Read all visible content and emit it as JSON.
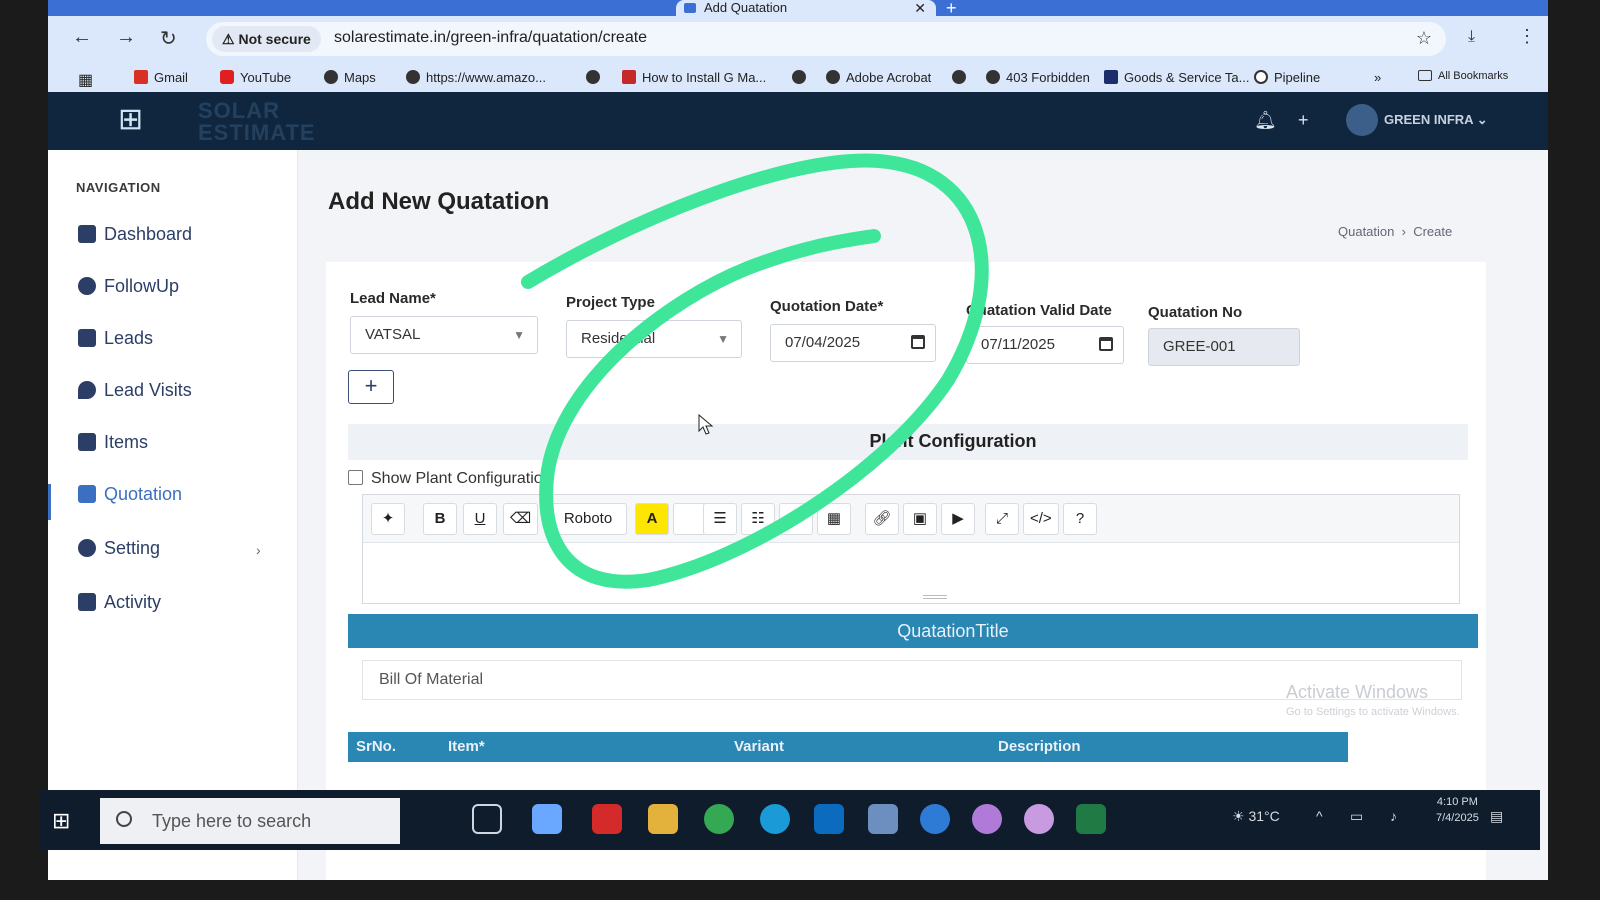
{
  "browser": {
    "tab_title": "Add Quatation",
    "security_label": "Not secure",
    "url": "solarestimate.in/green-infra/quatation/create",
    "bookmarks": [
      "Gmail",
      "YouTube",
      "Maps",
      "https://www.amazo...",
      "How to Install G Ma...",
      "Adobe Acrobat",
      "403 Forbidden",
      "Goods & Service Ta...",
      "Pipeline",
      "All Bookmarks"
    ]
  },
  "header": {
    "logo_text": "SOLAR ESTIMATE",
    "user_name": "GREEN INFRA"
  },
  "sidebar": {
    "title": "NAVIGATION",
    "items": [
      {
        "label": "Dashboard"
      },
      {
        "label": "FollowUp"
      },
      {
        "label": "Leads"
      },
      {
        "label": "Lead Visits"
      },
      {
        "label": "Items"
      },
      {
        "label": "Quotation"
      },
      {
        "label": "Setting"
      },
      {
        "label": "Activity"
      }
    ]
  },
  "main": {
    "page_title": "Add New Quatation",
    "breadcrumb": {
      "parent": "Quatation",
      "current": "Create"
    },
    "form": {
      "lead_name_label": "Lead Name*",
      "lead_name_value": "VATSAL",
      "project_type_label": "Project Type",
      "project_type_value": "Residential",
      "quotation_date_label": "Quotation Date*",
      "quotation_date_value": "07/04/2025",
      "valid_date_label": "Quatation Valid Date",
      "valid_date_value": "07/11/2025",
      "quotation_no_label": "Quatation No",
      "quotation_no_value": "GREE-001"
    },
    "plant_configuration_title": "Plant Configuration",
    "show_plant_configuration_label": "Show Plant Configuration",
    "editor": {
      "font_name": "Roboto"
    },
    "quotation_title_bar": "QuatationTitle",
    "bom_value": "Bill Of Material",
    "table_headers": [
      "SrNo.",
      "Item*",
      "Variant",
      "Description"
    ],
    "watermark": {
      "title": "Activate Windows",
      "subtitle": "Go to Settings to activate Windows."
    }
  },
  "taskbar": {
    "search_placeholder": "Type here to search",
    "temperature": "31°C",
    "time": "4:10 PM",
    "date": "7/4/2025"
  },
  "colors": {
    "header_bg": "#10263f",
    "accent": "#2a86b3",
    "scribble": "#3fe69a"
  }
}
